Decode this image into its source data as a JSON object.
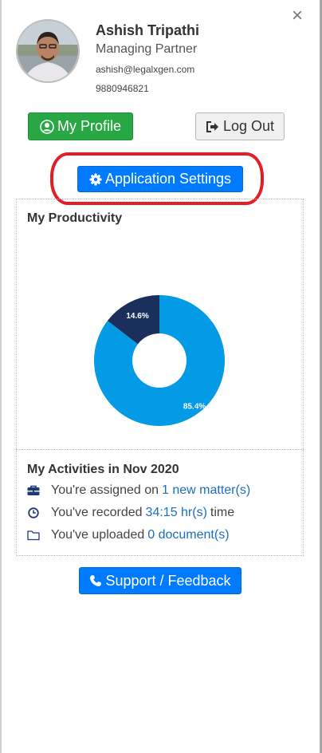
{
  "user": {
    "name": "Ashish Tripathi",
    "role": "Managing Partner",
    "email": "ashish@legalxgen.com",
    "phone": "9880946821"
  },
  "actions": {
    "close_icon": "close-icon",
    "profile_label": "My Profile",
    "logout_label": "Log Out",
    "settings_label": "Application Settings",
    "support_label": "Support / Feedback"
  },
  "productivity": {
    "title": "My Productivity",
    "chart_data": {
      "type": "pie",
      "categories": [
        "",
        ""
      ],
      "values": [
        85.4,
        14.6
      ],
      "labels": [
        "85.4%",
        "14.6%"
      ],
      "colors": [
        "#039be5",
        "#1a2f5c"
      ]
    }
  },
  "activities": {
    "title": "My Activities in Nov 2020",
    "items": [
      {
        "icon": "briefcase-icon",
        "prefix": "You're assigned on",
        "link": "1 new matter(s)",
        "suffix": ""
      },
      {
        "icon": "clock-icon",
        "prefix": "You've recorded",
        "link": "34:15 hr(s)",
        "suffix": "time"
      },
      {
        "icon": "folder-icon",
        "prefix": "You've uploaded",
        "link": "0 document(s)",
        "suffix": ""
      }
    ]
  },
  "colors": {
    "primary": "#007bff",
    "success": "#28a745",
    "highlight": "#e41e26",
    "link": "#1a6fc0"
  }
}
